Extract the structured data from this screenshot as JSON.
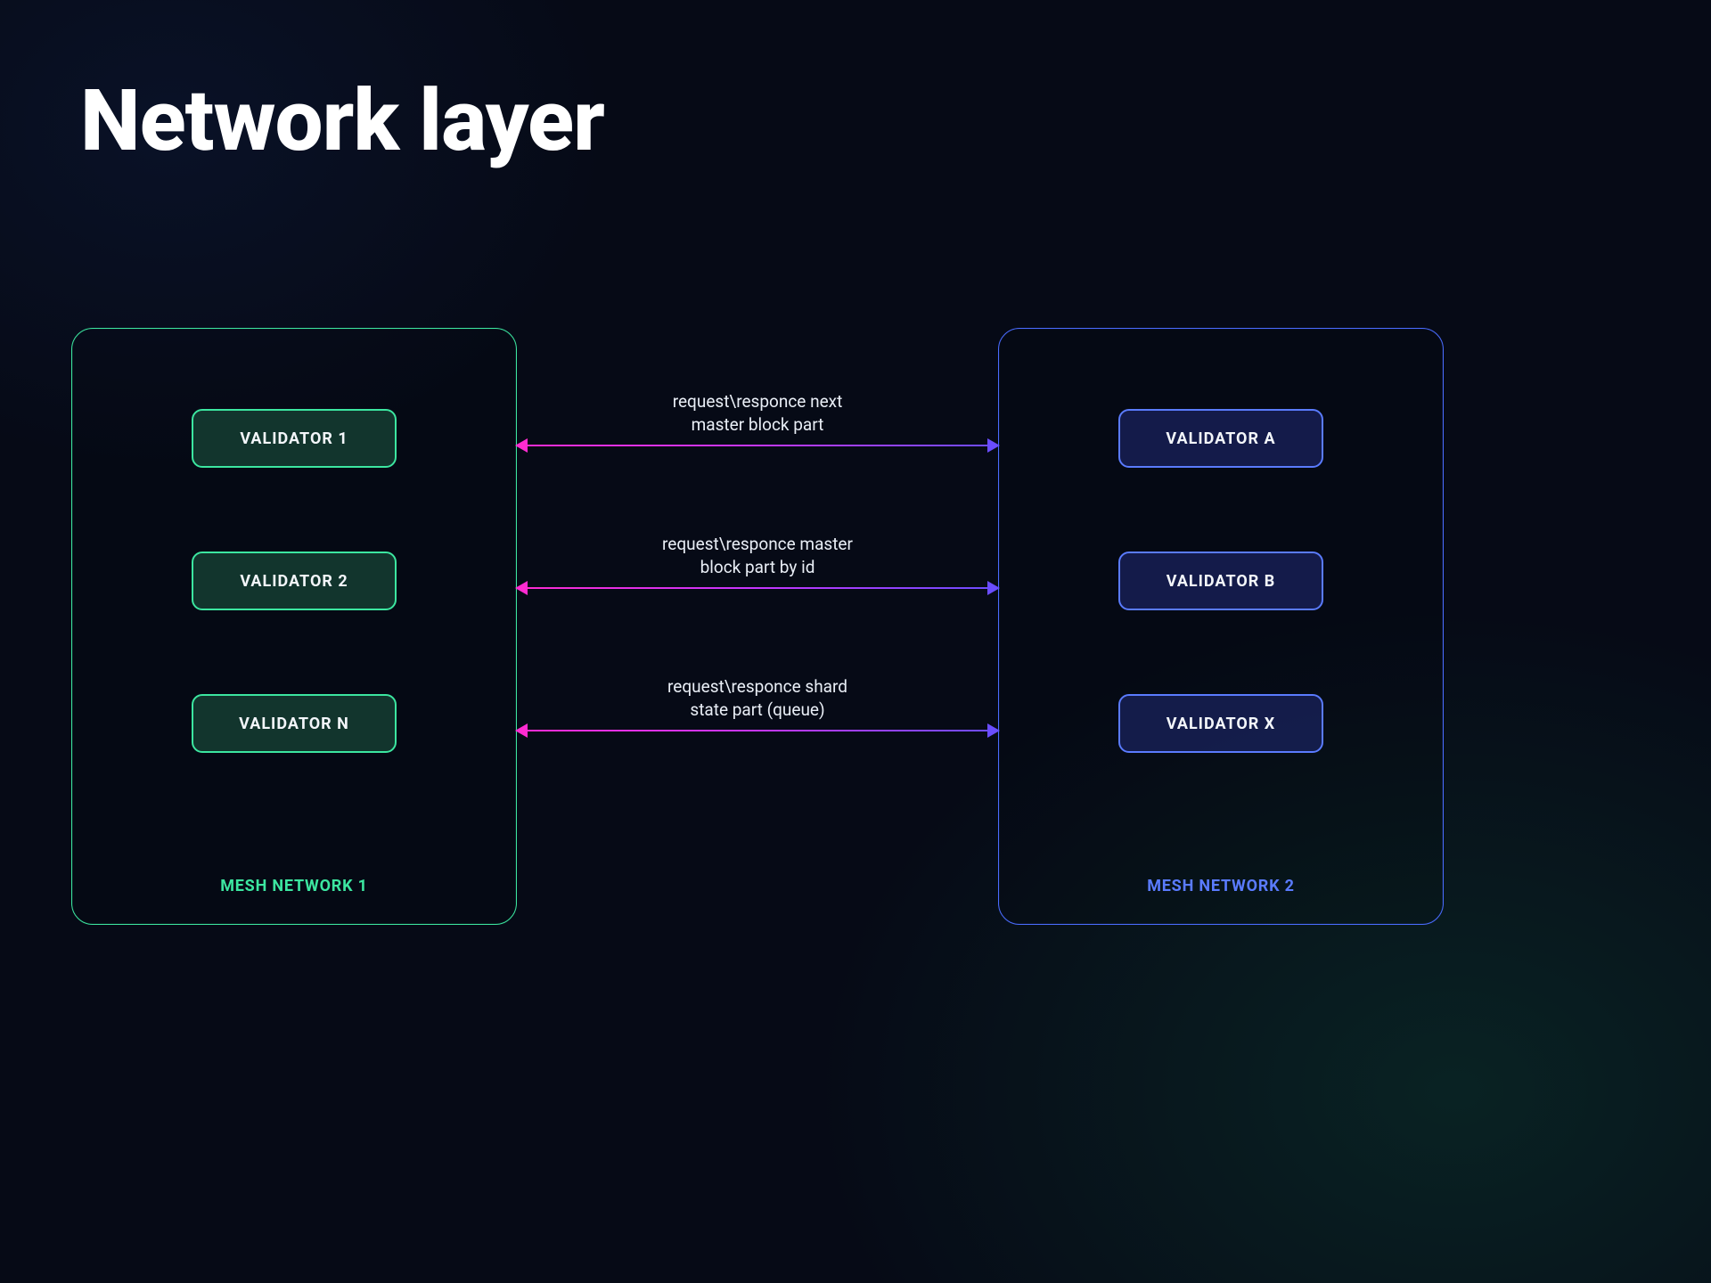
{
  "title": "Network layer",
  "mesh_networks": {
    "left": {
      "label": "MESH NETWORK 1",
      "validators": [
        "VALIDATOR 1",
        "VALIDATOR 2",
        "VALIDATOR N"
      ]
    },
    "right": {
      "label": "MESH NETWORK 2",
      "validators": [
        "VALIDATOR A",
        "VALIDATOR B",
        "VALIDATOR X"
      ]
    }
  },
  "connections": [
    {
      "line1": "request\\responce next",
      "line2": "master block part"
    },
    {
      "line1": "request\\responce master",
      "line2": "block part by id"
    },
    {
      "line1": "request\\responce shard",
      "line2": "state part (queue)"
    }
  ],
  "colors": {
    "green_border": "#3ce6a0",
    "blue_border": "#4a6cff",
    "arrow_gradient_start": "#ff2bd1",
    "arrow_gradient_end": "#6a4dff"
  }
}
